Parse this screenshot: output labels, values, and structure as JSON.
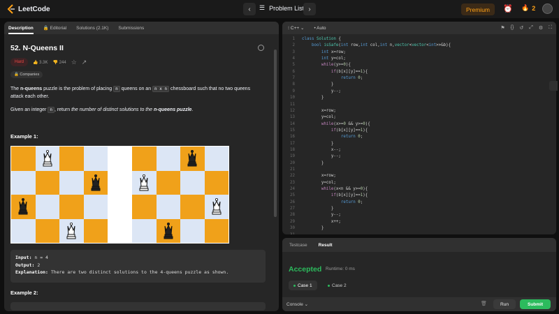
{
  "header": {
    "logo_text": "LeetCode",
    "problem_list_label": "Problem List",
    "premium_label": "Premium",
    "streak_count": "2"
  },
  "left_tabs": [
    {
      "label": "Description"
    },
    {
      "label": "Editorial"
    },
    {
      "label": "Solutions (2.1K)"
    },
    {
      "label": "Submissions"
    }
  ],
  "problem": {
    "title": "52. N-Queens II",
    "difficulty": "Hard",
    "likes": "3.3K",
    "dislikes": "244",
    "companies_label": "Companies",
    "desc1_a": "The ",
    "desc1_b": "n-queens",
    "desc1_c": " puzzle is the problem of placing ",
    "desc1_n": "n",
    "desc1_d": " queens on an ",
    "desc1_nxn": "n x n",
    "desc1_e": " chessboard such that no two queens attack each other.",
    "desc2_a": "Given an integer ",
    "desc2_n": "n",
    "desc2_b": ", return ",
    "desc2_c": "the number of distinct solutions to the ",
    "desc2_d": "n-queens puzzle",
    "desc2_e": ".",
    "example1_title": "Example 1:",
    "example1_input_label": "Input:",
    "example1_input": "n = 4",
    "example1_output_label": "Output:",
    "example1_output": "2",
    "example1_expl_label": "Explanation:",
    "example1_expl": "There are two distinct solutions to the 4-queens puzzle as shown.",
    "example2_title": "Example 2:"
  },
  "editor": {
    "language": "C++",
    "mode": "Auto",
    "lines": [
      "class Solution {",
      "    bool isSafe(int row,int col,int n,vector<vector<int>>&b){",
      "        int x=row;",
      "        int y=col;",
      "        while(y>=0){",
      "            if(b[x][y]==1){",
      "                return 0;",
      "            }",
      "            y--;",
      "        }",
      "",
      "        x=row;",
      "        y=col;",
      "        while(x>=0 && y>=0){",
      "            if(b[x][y]==1){",
      "                return 0;",
      "            }",
      "            x--;",
      "            y--;",
      "        }",
      "",
      "        x=row;",
      "        y=col;",
      "        while(x<n && y>=0){",
      "            if(b[x][y]==1){",
      "                return 0;",
      "            }",
      "            y--;",
      "            x++;",
      "        }",
      ""
    ]
  },
  "result": {
    "tabs": [
      {
        "label": "Testcase"
      },
      {
        "label": "Result"
      }
    ],
    "status": "Accepted",
    "runtime": "Runtime: 0 ms",
    "cases": [
      {
        "label": "Case 1"
      },
      {
        "label": "Case 2"
      }
    ],
    "console_label": "Console",
    "run_label": "Run",
    "submit_label": "Submit"
  },
  "colors": {
    "accent": "#ffa116",
    "accepted": "#2cbb5d",
    "hard": "#ef4743"
  }
}
